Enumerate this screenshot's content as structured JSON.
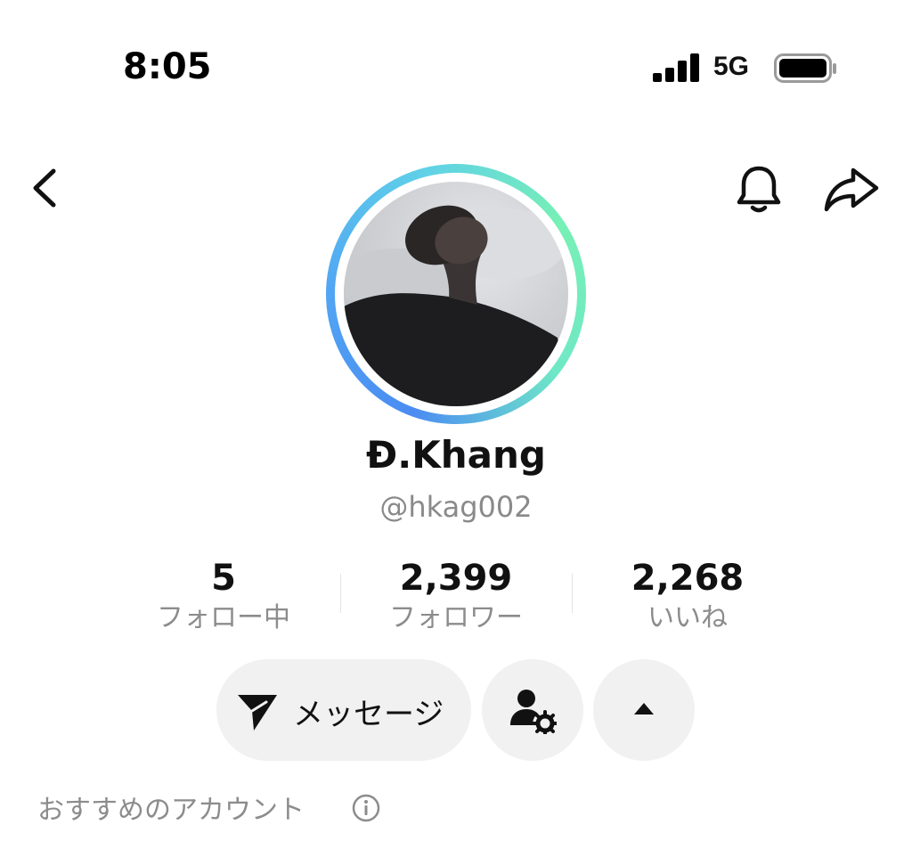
{
  "status_bar": {
    "time": "8:05",
    "network": "5G"
  },
  "nav": {
    "back_icon": "chevron-left-icon",
    "bell_icon": "bell-icon",
    "share_icon": "share-arrow-icon"
  },
  "profile": {
    "display_name": "Đ.Khang",
    "username": "@hkag002",
    "ring_colors": [
      "#4b8cf2",
      "#77f0b5"
    ]
  },
  "stats": [
    {
      "value": "5",
      "label": "フォロー中"
    },
    {
      "value": "2,399",
      "label": "フォロワー"
    },
    {
      "value": "2,268",
      "label": "いいね"
    }
  ],
  "actions": {
    "message_label": "メッセージ",
    "message_icon": "send-icon",
    "person_settings_icon": "person-gear-icon",
    "expand_icon": "caret-up-icon"
  },
  "suggested": {
    "label": "おすすめのアカウント",
    "info_icon": "info-icon"
  }
}
